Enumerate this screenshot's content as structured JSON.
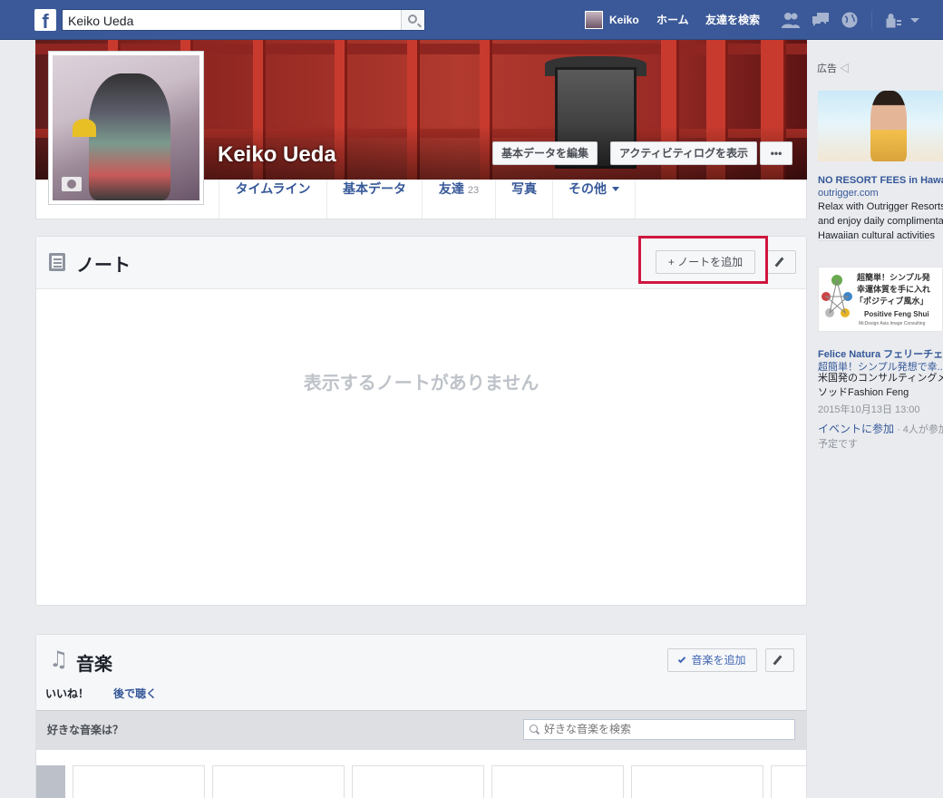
{
  "topbar": {
    "search_value": "Keiko Ueda",
    "user_name": "Keiko",
    "home": "ホーム",
    "find_friends": "友達を検索"
  },
  "profile": {
    "name": "Keiko Ueda",
    "edit_about": "基本データを編集",
    "view_activity_log": "アクティビティログを表示",
    "more": "•••"
  },
  "tabs": [
    {
      "label": "タイムライン"
    },
    {
      "label": "基本データ"
    },
    {
      "label": "友達",
      "count": "23"
    },
    {
      "label": "写真"
    },
    {
      "label": "その他"
    }
  ],
  "notes": {
    "title": "ノート",
    "add_button": "+ ノートを追加",
    "empty_message": "表示するノートがありません"
  },
  "music": {
    "title": "音楽",
    "add_button": "音楽を追加",
    "tabs": [
      "いいね！",
      "後で聴く"
    ],
    "prompt": "好きな音楽は？",
    "search_placeholder": "好きな音楽を検索"
  },
  "ads": {
    "label": "広告",
    "ad1": {
      "title": "NO RESORT FEES in Hawa",
      "domain": "outrigger.com",
      "lines": [
        "Relax with Outrigger Resorts",
        "and enjoy daily complimentar",
        "Hawaiian cultural activities"
      ]
    },
    "ad2": {
      "image_lines": [
        "超簡単！シンプル発",
        "幸運体質を手に入れ",
        "「ポジティブ風水」",
        "Positive Feng Shui",
        "McDesign Asia Image Consulting"
      ],
      "title": "Felice Natura フェリーチェ",
      "subtitle": "超簡単！シンプル発想で幸...",
      "lines": [
        "米国発のコンサルティングメ",
        "ソッドFashion Feng"
      ],
      "date": "2015年10月13日 13:00",
      "join_link": "イベントに参加",
      "join_suffix": "· 4人が参加",
      "join_line2": "予定です"
    }
  },
  "colors": {
    "brand": "#3b5998",
    "link": "#365899",
    "highlight": "#d0163f"
  }
}
